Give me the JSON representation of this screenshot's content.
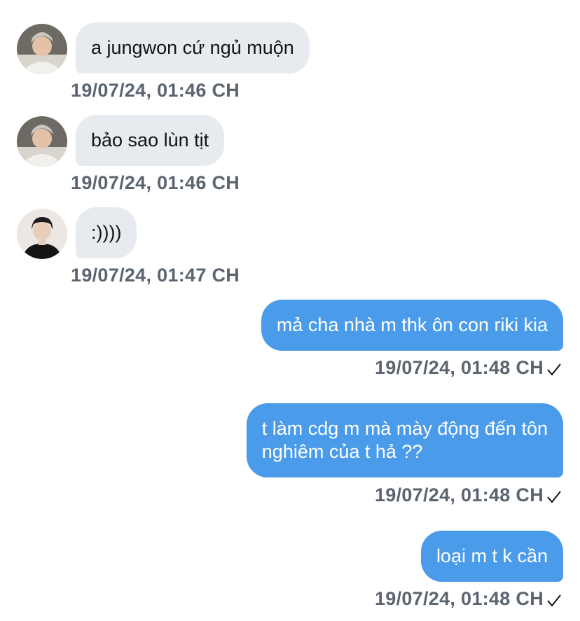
{
  "messages": [
    {
      "text": "a jungwon cứ ngủ muộn",
      "time": "19/07/24, 01:46 CH",
      "direction": "in",
      "sender_avatar": "avatar-1"
    },
    {
      "text": "bảo sao lùn tịt",
      "time": "19/07/24, 01:46 CH",
      "direction": "in",
      "sender_avatar": "avatar-1"
    },
    {
      "text": ":))))",
      "time": "19/07/24, 01:47 CH",
      "direction": "in",
      "sender_avatar": "avatar-2"
    },
    {
      "text": "mả cha nhà m thk ôn con riki kia",
      "time": "19/07/24, 01:48 CH",
      "direction": "out",
      "status_icon": "checkmark-icon"
    },
    {
      "text_lines": [
        "t làm cdg m mà mày động đến tôn",
        "nghiêm của t hả ??"
      ],
      "time": "19/07/24, 01:48 CH",
      "direction": "out",
      "status_icon": "checkmark-icon"
    },
    {
      "text": "loại m t k cần",
      "time": "19/07/24, 01:48 CH",
      "direction": "out",
      "status_icon": "checkmark-icon"
    }
  ],
  "colors": {
    "outgoing_bubble": "#4a9bea",
    "incoming_bubble": "#e7ebef",
    "timestamp": "#5b6570"
  }
}
